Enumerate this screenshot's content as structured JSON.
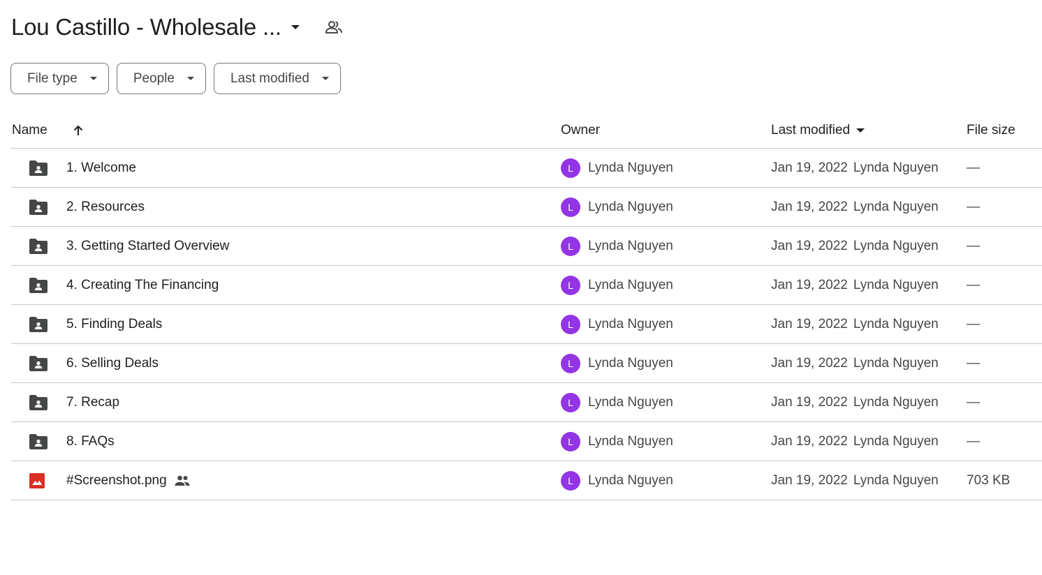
{
  "header": {
    "title": "Lou Castillo - Wholesale ...",
    "title_caret_icon": "arrow-drop-down-icon",
    "shared_icon": "people-outline-icon"
  },
  "filters": [
    {
      "label": "File type",
      "icon": "arrow-drop-down-icon"
    },
    {
      "label": "People",
      "icon": "arrow-drop-down-icon"
    },
    {
      "label": "Last modified",
      "icon": "arrow-drop-down-icon"
    }
  ],
  "columns": {
    "name": "Name",
    "owner": "Owner",
    "last_modified": "Last modified",
    "file_size": "File size"
  },
  "rows": [
    {
      "name": "1. Welcome",
      "type": "shared-folder",
      "owner_initial": "L",
      "owner": "Lynda Nguyen",
      "modified_date": "Jan 19, 2022",
      "modified_by": "Lynda Nguyen",
      "size": "—"
    },
    {
      "name": "2. Resources",
      "type": "shared-folder",
      "owner_initial": "L",
      "owner": "Lynda Nguyen",
      "modified_date": "Jan 19, 2022",
      "modified_by": "Lynda Nguyen",
      "size": "—"
    },
    {
      "name": "3. Getting Started Overview",
      "type": "shared-folder",
      "owner_initial": "L",
      "owner": "Lynda Nguyen",
      "modified_date": "Jan 19, 2022",
      "modified_by": "Lynda Nguyen",
      "size": "—"
    },
    {
      "name": "4. Creating The Financing",
      "type": "shared-folder",
      "owner_initial": "L",
      "owner": "Lynda Nguyen",
      "modified_date": "Jan 19, 2022",
      "modified_by": "Lynda Nguyen",
      "size": "—"
    },
    {
      "name": "5. Finding Deals",
      "type": "shared-folder",
      "owner_initial": "L",
      "owner": "Lynda Nguyen",
      "modified_date": "Jan 19, 2022",
      "modified_by": "Lynda Nguyen",
      "size": "—"
    },
    {
      "name": "6. Selling Deals",
      "type": "shared-folder",
      "owner_initial": "L",
      "owner": "Lynda Nguyen",
      "modified_date": "Jan 19, 2022",
      "modified_by": "Lynda Nguyen",
      "size": "—"
    },
    {
      "name": "7. Recap",
      "type": "shared-folder",
      "owner_initial": "L",
      "owner": "Lynda Nguyen",
      "modified_date": "Jan 19, 2022",
      "modified_by": "Lynda Nguyen",
      "size": "—"
    },
    {
      "name": "8. FAQs",
      "type": "shared-folder",
      "owner_initial": "L",
      "owner": "Lynda Nguyen",
      "modified_date": "Jan 19, 2022",
      "modified_by": "Lynda Nguyen",
      "size": "—"
    },
    {
      "name": "#Screenshot.png",
      "type": "image",
      "shared": true,
      "owner_initial": "L",
      "owner": "Lynda Nguyen",
      "modified_date": "Jan 19, 2022",
      "modified_by": "Lynda Nguyen",
      "size": "703 KB"
    }
  ],
  "colors": {
    "avatar": "#9334e6",
    "folder_icon": "#444746",
    "image_icon": "#d93025",
    "divider": "#c7c7c7"
  }
}
